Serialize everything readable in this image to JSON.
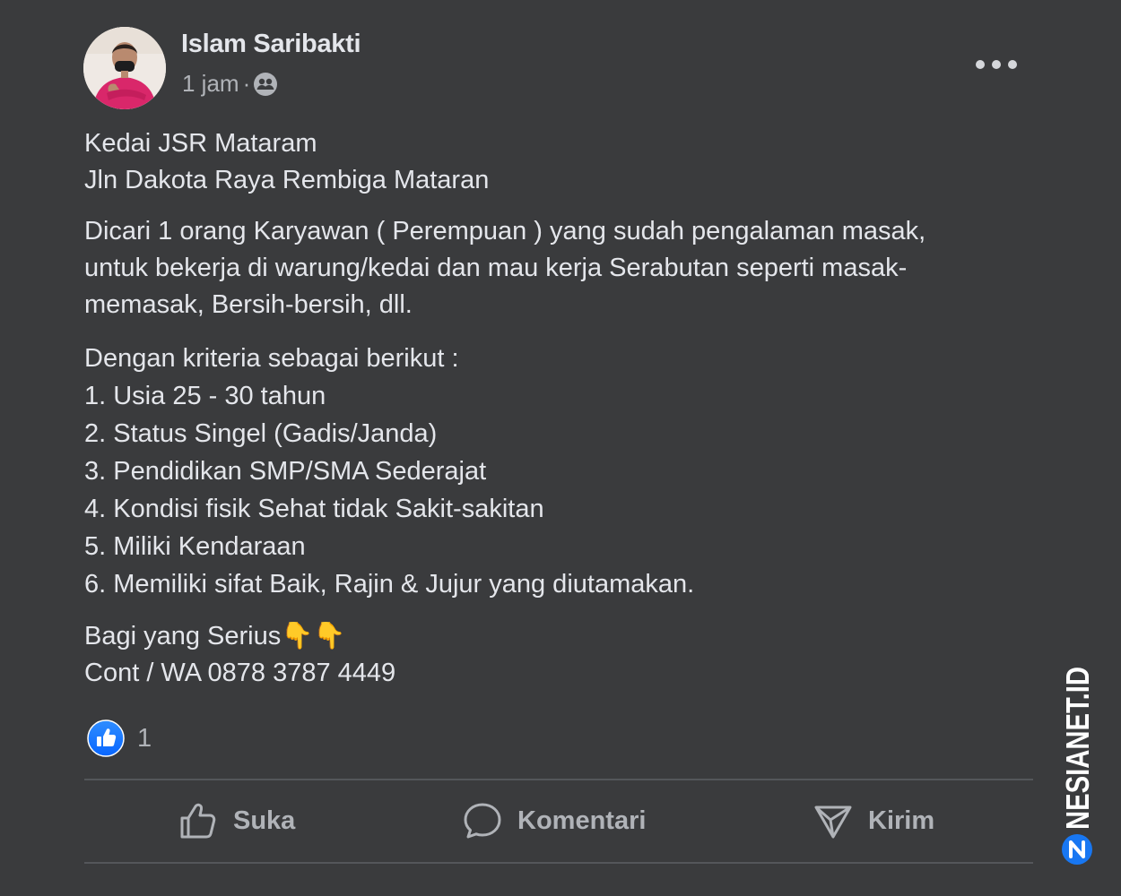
{
  "post": {
    "author": "Islam Saribakti",
    "time": "1 jam",
    "separator": "·",
    "privacy_icon": "friends-icon",
    "more_icon": "more-dots-icon",
    "content": {
      "p1": [
        "Kedai JSR Mataram",
        "Jln Dakota Raya Rembiga Mataran"
      ],
      "p2": [
        "Dicari 1 orang Karyawan ( Perempuan ) yang sudah pengalaman masak,",
        "untuk bekerja di warung/kedai dan mau kerja Serabutan seperti masak-",
        "memasak, Bersih-bersih, dll."
      ],
      "p3": [
        "Dengan kriteria sebagai berikut :",
        "1. Usia 25 - 30 tahun",
        "2. Status Singel (Gadis/Janda)",
        "3. Pendidikan SMP/SMA Sederajat",
        "4. Kondisi fisik Sehat tidak Sakit-sakitan",
        "5. Miliki Kendaraan",
        "6. Memiliki sifat Baik, Rajin & Jujur yang diutamakan."
      ],
      "p4": [
        "Bagi yang Serius👇👇",
        "Cont / WA 0878 3787 4449"
      ]
    },
    "reactions": {
      "icon": "like-reaction-icon",
      "count": "1"
    },
    "actions": {
      "like": {
        "label": "Suka",
        "icon": "thumbs-up-icon"
      },
      "comment": {
        "label": "Komentari",
        "icon": "comment-bubble-icon"
      },
      "send": {
        "label": "Kirim",
        "icon": "send-arrow-icon"
      }
    }
  },
  "watermark": {
    "text": "NESIANET.ID"
  },
  "colors": {
    "background": "#3a3b3d",
    "text": "#e4e6eb",
    "secondary": "#b0b3b8",
    "like_blue": "#1b74e4",
    "watermark": "#1877f2"
  }
}
